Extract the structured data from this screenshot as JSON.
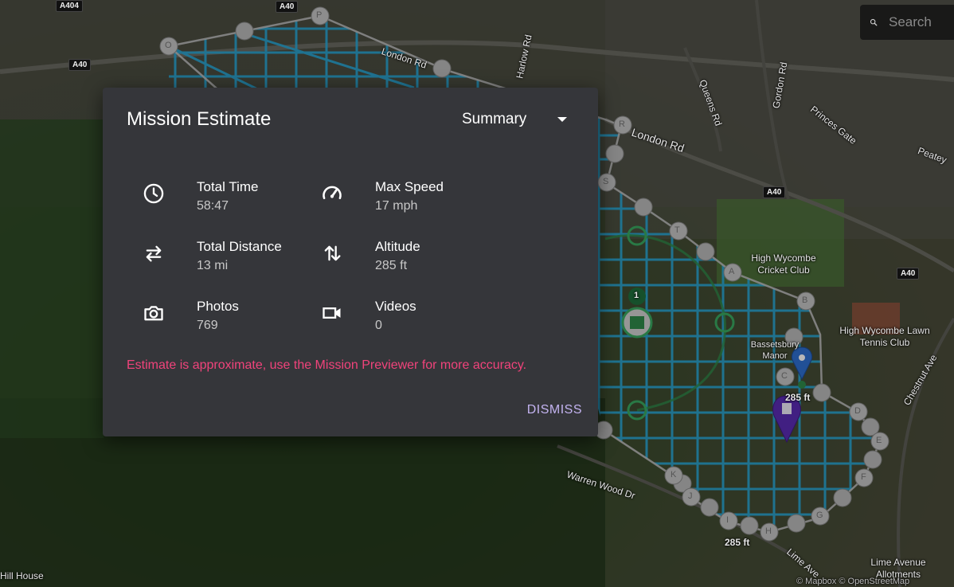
{
  "map": {
    "road_shields": [
      "A404",
      "A40",
      "A40",
      "A40",
      "A40"
    ],
    "street_labels": [
      "London Rd",
      "London Rd",
      "Harlow Rd",
      "Queens Rd",
      "Gordon Rd",
      "Princes Gate",
      "Peatey",
      "Warren Wood Dr",
      "Lime Ave",
      "Chestnut Ave",
      "Hill House",
      "Lime Avenue Allotments"
    ],
    "place_labels": [
      "High Wycombe Cricket Club",
      "High Wycombe Lawn Tennis Club",
      "Bassetsbury Manor"
    ],
    "altitude_labels": [
      "285 ft",
      "285 ft"
    ],
    "waypoint_letters": [
      "O",
      "P",
      "R",
      "S",
      "T",
      "A",
      "B",
      "C",
      "D",
      "E",
      "F",
      "G",
      "H",
      "I",
      "J",
      "K"
    ],
    "marker_count": "1",
    "attribution": "© Mapbox © OpenStreetMap",
    "grid_color": "#2aa8d8",
    "polygon_color": "#bdbdbd"
  },
  "search": {
    "placeholder": "Search"
  },
  "dialog": {
    "title": "Mission Estimate",
    "view_select": "Summary",
    "stats": [
      {
        "icon": "clock-icon",
        "label": "Total Time",
        "value": "58:47"
      },
      {
        "icon": "speedometer-icon",
        "label": "Max Speed",
        "value": "17 mph"
      },
      {
        "icon": "distance-arrows-icon",
        "label": "Total Distance",
        "value": "13 mi"
      },
      {
        "icon": "altitude-arrows-icon",
        "label": "Altitude",
        "value": "285 ft"
      },
      {
        "icon": "camera-icon",
        "label": "Photos",
        "value": "769"
      },
      {
        "icon": "video-icon",
        "label": "Videos",
        "value": "0"
      }
    ],
    "warning": "Estimate is approximate, use the Mission Previewer for more accuracy.",
    "dismiss_label": "DISMISS",
    "warning_color": "#f0437b",
    "accent_color": "#c3b3f0"
  }
}
